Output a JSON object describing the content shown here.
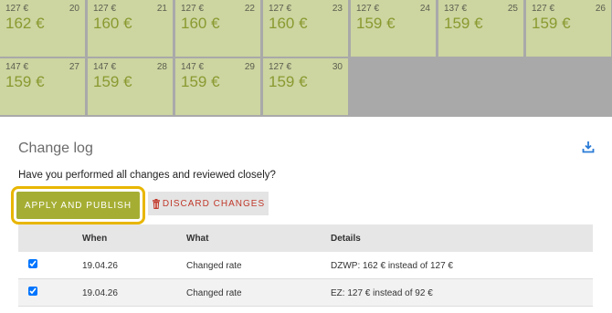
{
  "calendar": {
    "row1": [
      {
        "base": "127 €",
        "day": "20",
        "price": "162 €"
      },
      {
        "base": "127 €",
        "day": "21",
        "price": "160 €"
      },
      {
        "base": "127 €",
        "day": "22",
        "price": "160 €"
      },
      {
        "base": "127 €",
        "day": "23",
        "price": "160 €"
      },
      {
        "base": "127 €",
        "day": "24",
        "price": "159 €"
      },
      {
        "base": "137 €",
        "day": "25",
        "price": "159 €"
      },
      {
        "base": "127 €",
        "day": "26",
        "price": "159 €"
      }
    ],
    "row2": [
      {
        "base": "147 €",
        "day": "27",
        "price": "159 €"
      },
      {
        "base": "147 €",
        "day": "28",
        "price": "159 €"
      },
      {
        "base": "147 €",
        "day": "29",
        "price": "159 €"
      },
      {
        "base": "127 €",
        "day": "30",
        "price": "159 €"
      }
    ]
  },
  "changelog": {
    "title": "Change log",
    "question": "Have you performed all changes and reviewed closely?",
    "apply_label": "APPLY AND PUBLISH",
    "discard_label": "DISCARD CHANGES",
    "download_icon": "download-icon",
    "headers": {
      "when": "When",
      "what": "What",
      "details": "Details"
    },
    "rows": [
      {
        "checked": true,
        "when": "19.04.26",
        "what": "Changed rate",
        "prefix": "DZWP:",
        "new": "162 €",
        "rest": "instead of 127 €"
      },
      {
        "checked": true,
        "when": "19.04.26",
        "what": "Changed rate",
        "prefix": "EZ:",
        "new": "127 €",
        "rest": "instead of 92 €"
      }
    ]
  },
  "colors": {
    "accent": "#a5ae33",
    "highlight": "#e8b600",
    "danger": "#c0392b",
    "link": "#2a7bd6"
  }
}
